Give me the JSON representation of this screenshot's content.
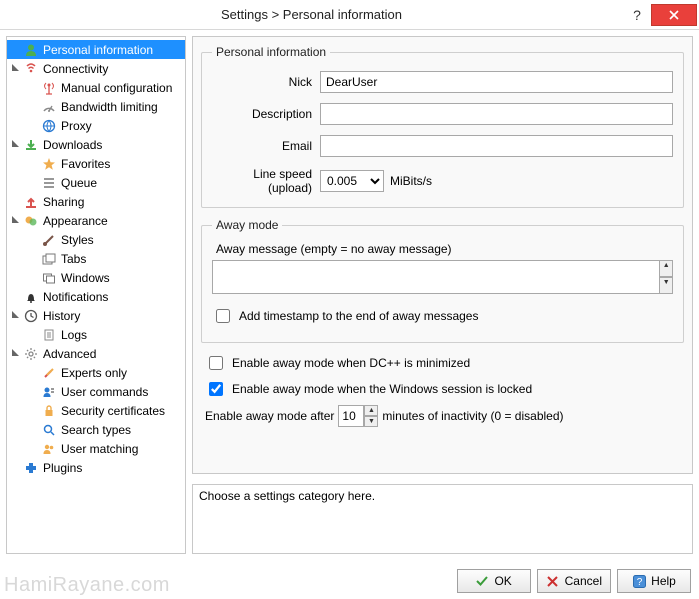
{
  "title": "Settings > Personal information",
  "tree": [
    {
      "label": "Personal information",
      "icon": "user-icon",
      "color": "#4caf50",
      "selected": true
    },
    {
      "label": "Connectivity",
      "icon": "signal-icon",
      "color": "#d9534f"
    },
    {
      "label": "Manual configuration",
      "icon": "antenna-icon",
      "color": "#d9534f",
      "child": true
    },
    {
      "label": "Bandwidth limiting",
      "icon": "gauge-icon",
      "color": "#888",
      "child": true
    },
    {
      "label": "Proxy",
      "icon": "globe-icon",
      "color": "#2a7ad2",
      "child": true
    },
    {
      "label": "Downloads",
      "icon": "download-icon",
      "color": "#4caf50"
    },
    {
      "label": "Favorites",
      "icon": "star-icon",
      "color": "#f0ad4e",
      "child": true
    },
    {
      "label": "Queue",
      "icon": "list-icon",
      "color": "#777",
      "child": true
    },
    {
      "label": "Sharing",
      "icon": "upload-icon",
      "color": "#d9534f"
    },
    {
      "label": "Appearance",
      "icon": "palette-icon",
      "color": "#f0ad4e"
    },
    {
      "label": "Styles",
      "icon": "brush-icon",
      "color": "#795548",
      "child": true
    },
    {
      "label": "Tabs",
      "icon": "tabs-icon",
      "color": "#777",
      "child": true
    },
    {
      "label": "Windows",
      "icon": "windows-icon",
      "color": "#777",
      "child": true
    },
    {
      "label": "Notifications",
      "icon": "bell-icon",
      "color": "#333"
    },
    {
      "label": "History",
      "icon": "clock-icon",
      "color": "#555"
    },
    {
      "label": "Logs",
      "icon": "log-icon",
      "color": "#888",
      "child": true
    },
    {
      "label": "Advanced",
      "icon": "gear-icon",
      "color": "#888"
    },
    {
      "label": "Experts only",
      "icon": "tools-icon",
      "color": "#d9534f",
      "child": true
    },
    {
      "label": "User commands",
      "icon": "user-cmd-icon",
      "color": "#2a7ad2",
      "child": true
    },
    {
      "label": "Security certificates",
      "icon": "lock-icon",
      "color": "#f0ad4e",
      "child": true
    },
    {
      "label": "Search types",
      "icon": "search-icon",
      "color": "#2a7ad2",
      "child": true
    },
    {
      "label": "User matching",
      "icon": "users-icon",
      "color": "#f0ad4e",
      "child": true
    },
    {
      "label": "Plugins",
      "icon": "plugin-icon",
      "color": "#2a7ad2"
    }
  ],
  "personal": {
    "legend": "Personal information",
    "nick_label": "Nick",
    "nick_value": "DearUser",
    "desc_label": "Description",
    "desc_value": "",
    "email_label": "Email",
    "email_value": "",
    "speed_label": "Line speed (upload)",
    "speed_value": "0.005",
    "speed_unit": "MiBits/s"
  },
  "away": {
    "legend": "Away mode",
    "msg_label": "Away message (empty = no away message)",
    "msg_value": "",
    "timestamp_label": "Add timestamp to the end of away messages",
    "timestamp_checked": false
  },
  "opts": {
    "minimize_label": "Enable away mode when DC++ is minimized",
    "minimize_checked": false,
    "lock_label": "Enable away mode when the Windows session is locked",
    "lock_checked": true,
    "inactivity_prefix": "Enable away mode after",
    "inactivity_value": "10",
    "inactivity_suffix": "minutes of inactivity (0 = disabled)"
  },
  "help_text": "Choose a settings category here.",
  "buttons": {
    "ok": "OK",
    "cancel": "Cancel",
    "help": "Help"
  },
  "watermark": "HamiRayane.com"
}
